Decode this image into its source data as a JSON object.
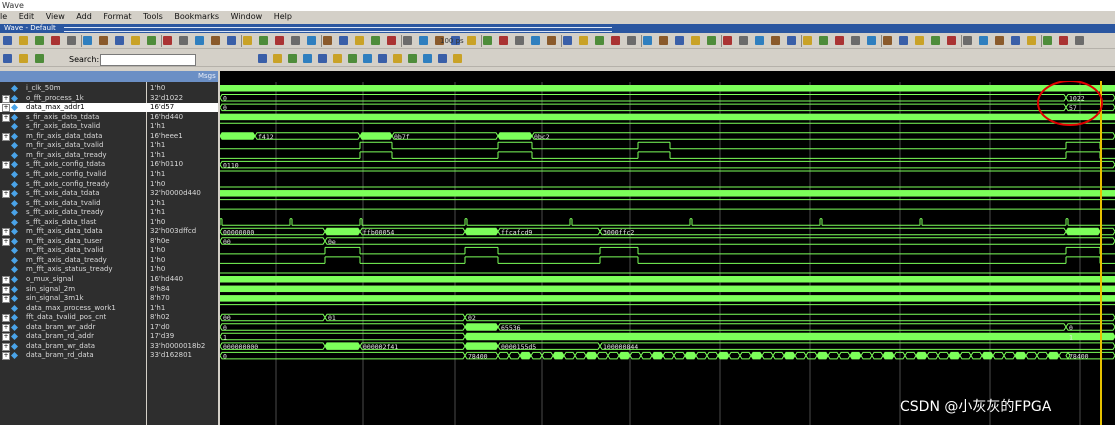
{
  "window": {
    "title": "Wave",
    "tab": "Wave - Default"
  },
  "menu": [
    "le",
    "Edit",
    "View",
    "Add",
    "Format",
    "Tools",
    "Bookmarks",
    "Window",
    "Help"
  ],
  "toolbar": {
    "search_label": "Search:",
    "zoom_value": "100 ps"
  },
  "header": {
    "msgs_label": "Msgs"
  },
  "colors": {
    "wave_bg": "#000000",
    "signal": "#7cff5a",
    "cursor": "#e6c200",
    "annotation": "#e00000",
    "selected_row": "#ffffff"
  },
  "signals": [
    {
      "name": "i_clk_50m",
      "value": "1'h0",
      "expandable": false
    },
    {
      "name": "o_fft_process_1k",
      "value": "32'd1022",
      "expandable": true
    },
    {
      "name": "data_max_addr1",
      "value": "16'd57",
      "expandable": true,
      "selected": true
    },
    {
      "name": "s_fir_axis_data_tdata",
      "value": "16'hd440",
      "expandable": true
    },
    {
      "name": "s_fir_axis_data_tvalid",
      "value": "1'h1",
      "expandable": false
    },
    {
      "name": "m_fir_axis_data_tdata",
      "value": "16'heee1",
      "expandable": true
    },
    {
      "name": "m_fir_axis_data_tvalid",
      "value": "1'h1",
      "expandable": false
    },
    {
      "name": "m_fir_axis_data_tready",
      "value": "1'h1",
      "expandable": false
    },
    {
      "name": "s_fft_axis_config_tdata",
      "value": "16'h0110",
      "expandable": true
    },
    {
      "name": "s_fft_axis_config_tvalid",
      "value": "1'h1",
      "expandable": false
    },
    {
      "name": "s_fft_axis_config_tready",
      "value": "1'h0",
      "expandable": false
    },
    {
      "name": "s_fft_axis_data_tdata",
      "value": "32'h0000d440",
      "expandable": true
    },
    {
      "name": "s_fft_axis_data_tvalid",
      "value": "1'h1",
      "expandable": false
    },
    {
      "name": "s_fft_axis_data_tready",
      "value": "1'h1",
      "expandable": false
    },
    {
      "name": "s_fft_axis_data_tlast",
      "value": "1'h0",
      "expandable": false
    },
    {
      "name": "m_fft_axis_data_tdata",
      "value": "32'h003dffcd",
      "expandable": true
    },
    {
      "name": "m_fft_axis_data_tuser",
      "value": "8'h0e",
      "expandable": true
    },
    {
      "name": "m_fft_axis_data_tvalid",
      "value": "1'h0",
      "expandable": false
    },
    {
      "name": "m_fft_axis_data_tready",
      "value": "1'h0",
      "expandable": false
    },
    {
      "name": "m_fft_axis_status_tready",
      "value": "1'h0",
      "expandable": false
    },
    {
      "name": "o_mux_signal",
      "value": "16'hd440",
      "expandable": true
    },
    {
      "name": "sin_signal_2m",
      "value": "8'h84",
      "expandable": true
    },
    {
      "name": "sin_signal_3m1k",
      "value": "8'h70",
      "expandable": true
    },
    {
      "name": "data_max_process_work1",
      "value": "1'h1",
      "expandable": false
    },
    {
      "name": "fft_data_tvalid_pos_cnt",
      "value": "8'h02",
      "expandable": true
    },
    {
      "name": "data_bram_wr_addr",
      "value": "17'd0",
      "expandable": true
    },
    {
      "name": "data_bram_rd_addr",
      "value": "17'd39",
      "expandable": true
    },
    {
      "name": "data_bram_wr_data",
      "value": "33'h0000018b2",
      "expandable": true
    },
    {
      "name": "data_bram_rd_data",
      "value": "33'd162801",
      "expandable": true
    }
  ],
  "wave_labels": [
    {
      "row": 1,
      "text": "0",
      "pos": "start"
    },
    {
      "row": 1,
      "text": "1022",
      "pos": "end"
    },
    {
      "row": 2,
      "text": "0",
      "pos": "start"
    },
    {
      "row": 2,
      "text": "57",
      "pos": "end"
    },
    {
      "row": 5,
      "text": "f412",
      "pos": "a"
    },
    {
      "row": 5,
      "text": "0b7f",
      "pos": "b"
    },
    {
      "row": 5,
      "text": "0bc2",
      "pos": "c"
    },
    {
      "row": 8,
      "text": "0110",
      "pos": "start"
    },
    {
      "row": 15,
      "text": "00000000",
      "pos": "start"
    },
    {
      "row": 15,
      "text": "ffb00054",
      "pos": "a"
    },
    {
      "row": 15,
      "text": "ffcafcd9",
      "pos": "b"
    },
    {
      "row": 15,
      "text": "3000ffc2",
      "pos": "c"
    },
    {
      "row": 16,
      "text": "00",
      "pos": "start"
    },
    {
      "row": 16,
      "text": "0e",
      "pos": "a"
    },
    {
      "row": 24,
      "text": "00",
      "pos": "start"
    },
    {
      "row": 24,
      "text": "01",
      "pos": "a"
    },
    {
      "row": 24,
      "text": "02",
      "pos": "b"
    },
    {
      "row": 25,
      "text": "0",
      "pos": "start"
    },
    {
      "row": 25,
      "text": "65536",
      "pos": "b"
    },
    {
      "row": 25,
      "text": "0",
      "pos": "end"
    },
    {
      "row": 26,
      "text": "1",
      "pos": "start"
    },
    {
      "row": 26,
      "text": "1",
      "pos": "end"
    },
    {
      "row": 27,
      "text": "000000000",
      "pos": "start"
    },
    {
      "row": 27,
      "text": "000002f41",
      "pos": "a"
    },
    {
      "row": 27,
      "text": "0000155d5",
      "pos": "b"
    },
    {
      "row": 27,
      "text": "100000844",
      "pos": "c"
    },
    {
      "row": 28,
      "text": "0",
      "pos": "start"
    },
    {
      "row": 28,
      "text": "78400",
      "pos": "b"
    },
    {
      "row": 28,
      "text": "78400",
      "pos": "end"
    }
  ],
  "watermark": "CSDN @小灰灰的FPGA"
}
